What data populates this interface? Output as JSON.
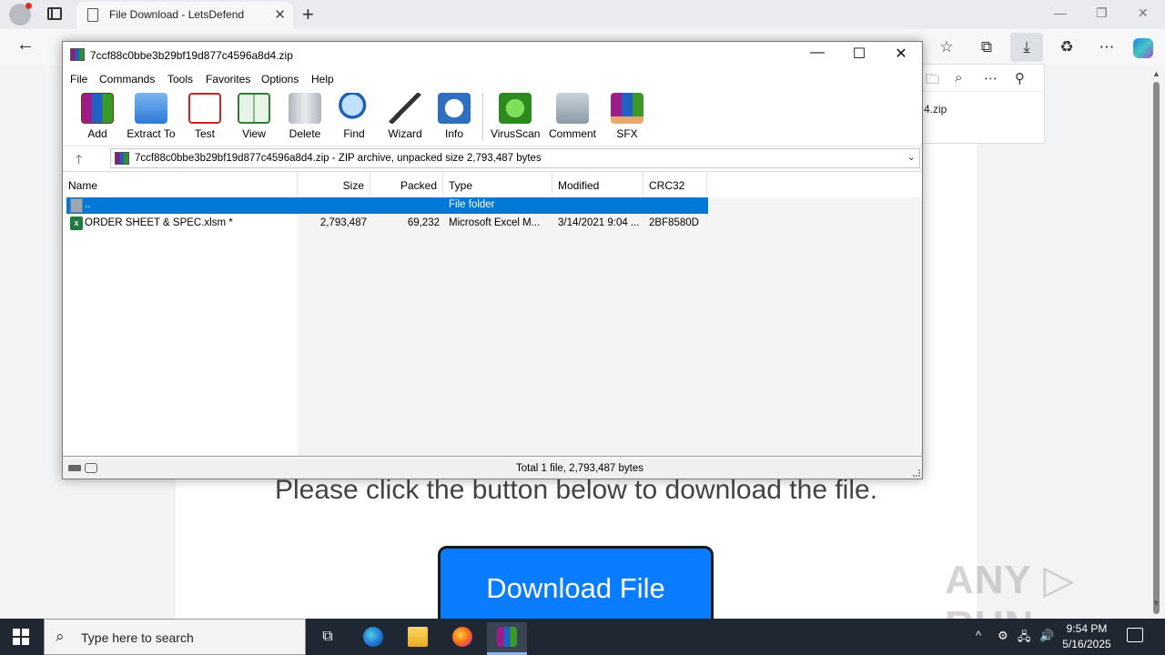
{
  "browser": {
    "tab_title": "File Download - LetsDefend",
    "tab_close": "✕",
    "new_tab": "+",
    "window_controls": [
      "—",
      "❐",
      "✕"
    ]
  },
  "toolbar": {
    "back": "←",
    "favorites_icon": "☆",
    "collections_icon": "⧉",
    "downloads_icon": "⤓",
    "extensions_icon": "♻",
    "more_icon": "⋯"
  },
  "downloads_panel": {
    "file_suffix": "4.zip",
    "icons": [
      "🗀",
      "⌕",
      "⋯",
      "⚲"
    ]
  },
  "page": {
    "prompt": "Please click the button below to download the file.",
    "download_button": "Download File",
    "watermark": "ANY ▷ RUN"
  },
  "winrar": {
    "title": "7ccf88c0bbe3b29bf19d877c4596a8d4.zip",
    "controls": [
      "—",
      "☐",
      "✕"
    ],
    "menu": [
      "File",
      "Commands",
      "Tools",
      "Favorites",
      "Options",
      "Help"
    ],
    "tools": [
      "Add",
      "Extract To",
      "Test",
      "View",
      "Delete",
      "Find",
      "Wizard",
      "Info",
      "VirusScan",
      "Comment",
      "SFX"
    ],
    "address": "7ccf88c0bbe3b29bf19d877c4596a8d4.zip - ZIP archive, unpacked size 2,793,487 bytes",
    "columns": [
      "Name",
      "Size",
      "Packed",
      "Type",
      "Modified",
      "CRC32"
    ],
    "rows": [
      {
        "name": "..",
        "size": "",
        "packed": "",
        "type": "File folder",
        "modified": "",
        "crc": ""
      },
      {
        "name": "ORDER SHEET & SPEC.xlsm *",
        "size": "2,793,487",
        "packed": "69,232",
        "type": "Microsoft Excel M...",
        "modified": "3/14/2021 9:04 ...",
        "crc": "2BF8580D"
      }
    ],
    "status": "Total 1 file, 2,793,487 bytes"
  },
  "taskbar": {
    "search_placeholder": "Type here to search",
    "time": "9:54 PM",
    "date": "5/16/2025",
    "tray": [
      "^",
      "⚙",
      "🖧",
      "🔊"
    ]
  }
}
